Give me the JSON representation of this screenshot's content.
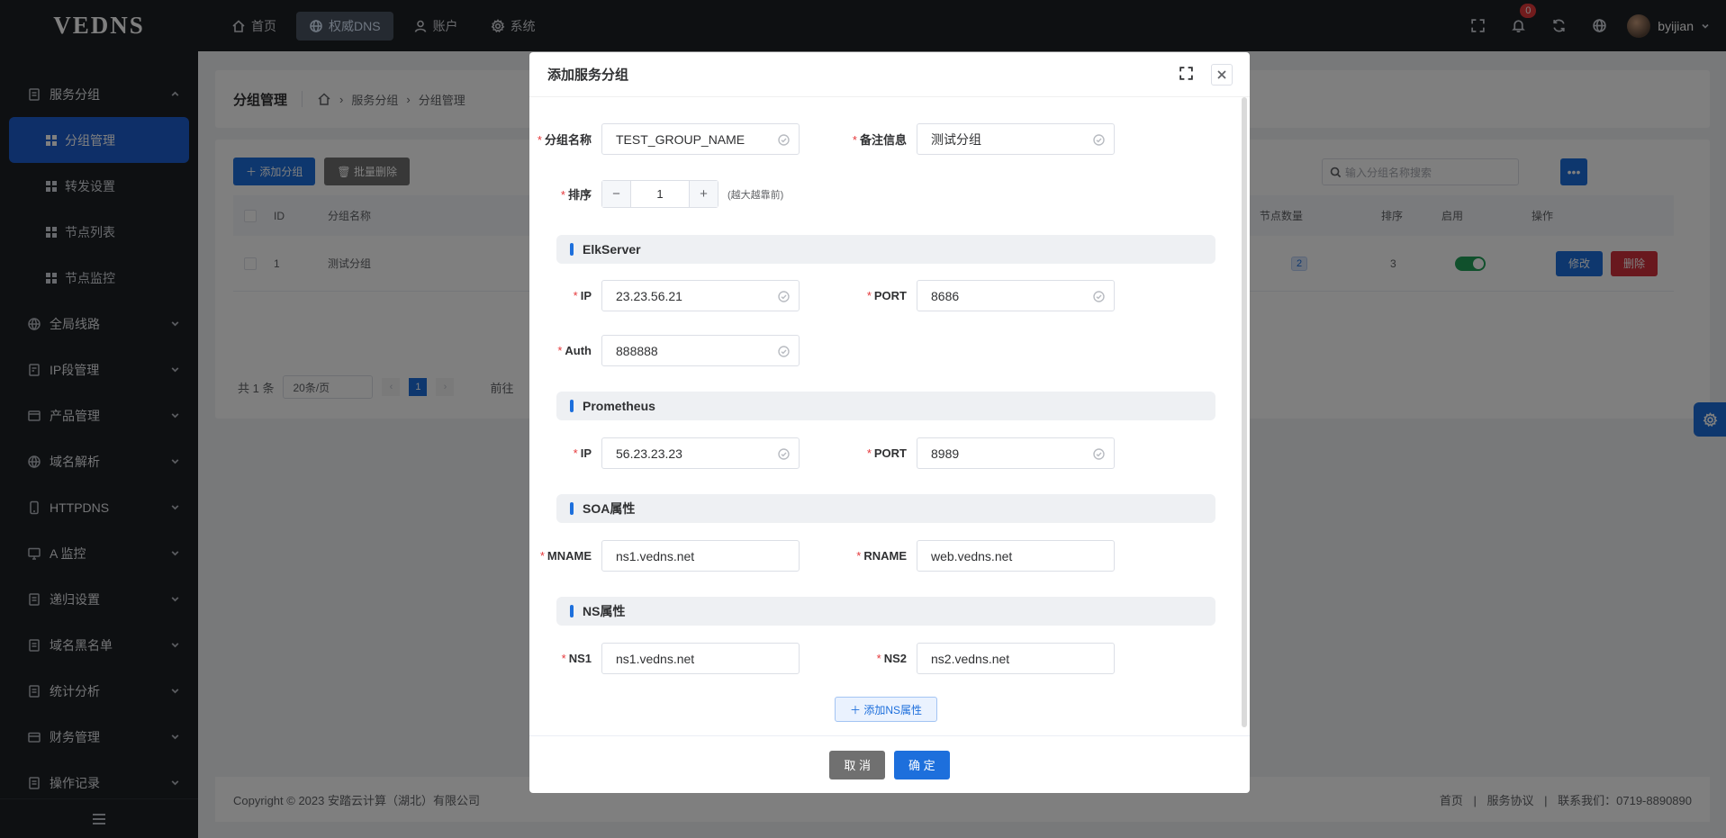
{
  "app": {
    "logo": "VEDNS"
  },
  "topnav": [
    {
      "label": "首页",
      "icon": "home-icon",
      "active": false
    },
    {
      "label": "权威DNS",
      "icon": "globe-icon",
      "active": true
    },
    {
      "label": "账户",
      "icon": "user-icon",
      "active": false
    },
    {
      "label": "系统",
      "icon": "gear-icon",
      "active": false
    }
  ],
  "header": {
    "notification_count": "0",
    "username": "byijian"
  },
  "sidebar": {
    "group_service": "服务分组",
    "sub_items": [
      "分组管理",
      "转发设置",
      "节点列表",
      "节点监控"
    ],
    "groups": [
      "全局线路",
      "IP段管理",
      "产品管理",
      "域名解析",
      "HTTPDNS",
      "A 监控",
      "递归设置",
      "域名黑名单",
      "统计分析",
      "财务管理",
      "操作记录"
    ]
  },
  "page": {
    "title": "分组管理",
    "breadcrumb": [
      "服务分组",
      "分组管理"
    ],
    "add_button": "添加分组",
    "batch_delete_button": "批量删除",
    "search_placeholder": "输入分组名称搜索",
    "more_button": "•••",
    "columns": {
      "id": "ID",
      "name": "分组名称",
      "nodes": "节点数量",
      "order": "排序",
      "enabled": "启用",
      "actions": "操作"
    },
    "rows": [
      {
        "id": "1",
        "name": "测试分组",
        "nodes": "2",
        "order": "3",
        "edit": "修改",
        "delete": "删除"
      }
    ],
    "pager": {
      "total": "共 1 条",
      "size": "20条/页",
      "current": "1",
      "goto": "前往"
    }
  },
  "footer": {
    "copyright": "Copyright © 2023 安踏云计算（湖北）有限公司",
    "links": [
      "首页",
      "|",
      "服务协议",
      "|",
      "联系我们：0719-8890890"
    ]
  },
  "dialog": {
    "title": "添加服务分组",
    "group_name_label": "分组名称",
    "group_name_value": "TEST_GROUP_NAME",
    "remark_label": "备注信息",
    "remark_value": "测试分组",
    "order_label": "排序",
    "order_value": "1",
    "order_hint": "(越大越靠前)",
    "sections": {
      "elk": "ElkServer",
      "prometheus": "Prometheus",
      "soa": "SOA属性",
      "ns": "NS属性"
    },
    "elk": {
      "ip_label": "IP",
      "ip_value": "23.23.56.21",
      "port_label": "PORT",
      "port_value": "8686",
      "auth_label": "Auth",
      "auth_value": "888888"
    },
    "prom": {
      "ip_label": "IP",
      "ip_value": "56.23.23.23",
      "port_label": "PORT",
      "port_value": "8989"
    },
    "soa": {
      "mname_label": "MNAME",
      "mname_value": "ns1.vedns.net",
      "rname_label": "RNAME",
      "rname_value": "web.vedns.net"
    },
    "ns": {
      "ns1_label": "NS1",
      "ns1_value": "ns1.vedns.net",
      "ns2_label": "NS2",
      "ns2_value": "ns2.vedns.net"
    },
    "add_ns_button": "添加NS属性",
    "cancel": "取 消",
    "confirm": "确 定",
    "required_mark": "*"
  },
  "colors": {
    "primary": "#1d6fdc",
    "danger": "#d3313c",
    "sidebar_bg": "#1d2024",
    "switch_on": "#21a058"
  }
}
